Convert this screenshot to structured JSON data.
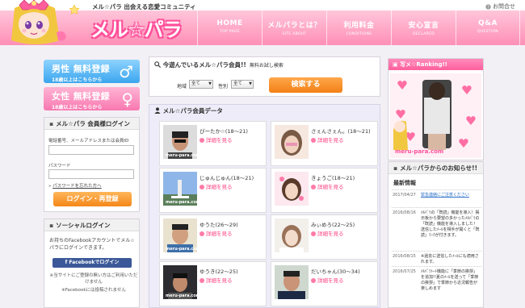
{
  "header": {
    "tagline": "メル☆パラ 出会える恋愛コミュニティ",
    "contact_label": "お問合せ",
    "brand": "メル☆パラ",
    "nav": [
      {
        "label": "HOME",
        "sub": "TOP PAGE"
      },
      {
        "label": "メルパラとは？",
        "sub": "SITE ABOUT"
      },
      {
        "label": "利用料金",
        "sub": "CONDITIONS"
      },
      {
        "label": "安心宣言",
        "sub": "DECLARED"
      },
      {
        "label": "Q&A",
        "sub": "QUESTION"
      }
    ]
  },
  "register": {
    "male": {
      "title": "男性 無料登録",
      "sub": "18歳以上はこちらから",
      "symbol": "♂"
    },
    "female": {
      "title": "女性 無料登録",
      "sub": "18歳以上はこちらから",
      "symbol": "♀"
    }
  },
  "login": {
    "heading": "メル☆パラ 会員様ログイン",
    "id_label": "電話番号、メールアドレスまたは会員ID",
    "password_label": "パスワード",
    "forgot_link": "パスワードを忘れた方へ",
    "button": "ログイン・再登録"
  },
  "social": {
    "heading": "ソーシャルログイン",
    "description": "お持ちのFacebookアカウントでメル☆パラにログインできます。",
    "fb_button": "Facebookでログイン",
    "note1": "※当サイトにご登録の無い方はご利用いただけません",
    "note2": "※Facebookには投稿されません"
  },
  "search": {
    "title": "今遊んでいるメル☆パラ会員!!",
    "trial": "無料お試し検索",
    "area_label": "地域",
    "area_value": "全て",
    "gender_label": "性別",
    "gender_value": "全て",
    "button": "検索する"
  },
  "members": {
    "title": "メル☆パラ会員データ",
    "detail_label": "詳細を見る",
    "items": [
      {
        "name": "ぴーたか☆(18〜21)"
      },
      {
        "name": "さぇんさぇん。(18〜21)"
      },
      {
        "name": "じゅんじゅん(18〜21)"
      },
      {
        "name": "きょうご(18〜21)"
      },
      {
        "name": "ゆうた(26〜29)"
      },
      {
        "name": "みぃめろ(22〜25)"
      },
      {
        "name": "ゆうき(22〜25)"
      },
      {
        "name": "だいちゃん(30〜34)"
      }
    ],
    "photo_watermark": "meru-para.com"
  },
  "ranking": {
    "heading": "写メ☆Ranking!!",
    "watermark": "meru-para.com"
  },
  "news": {
    "heading": "メル☆パラからのお知らせ!!",
    "subheading": "最新情報",
    "items": [
      {
        "date": "2017/04/27",
        "text": "緊急連絡にご注意ください"
      },
      {
        "date": "2016/08/16",
        "text": "ﾒﾙﾊﾟﾗの「既読」機能を導入！掲示板から要望の多かったﾒﾙﾊﾟﾗの「既読」機能を導入しました！送信したﾒｰﾙを相手が開くと「既読」ﾏｰｸが付きます。"
      },
      {
        "date": "2016/08/15",
        "text": "※過去に送信したﾒｰﾙにも適用されます。"
      },
      {
        "date": "2016/07/25",
        "text": "ﾒﾙﾊﾟﾗﾄｰﾄ機能に「季節の挨拶」を追加!!夏のﾒｰﾙを送って「季節の挨拶」で季節から近況報告が楽しめます"
      }
    ]
  },
  "colors": {
    "pink": "#ff5e9c",
    "orange": "#f28015",
    "blue": "#3aa5ee",
    "facebook": "#3b5998"
  }
}
